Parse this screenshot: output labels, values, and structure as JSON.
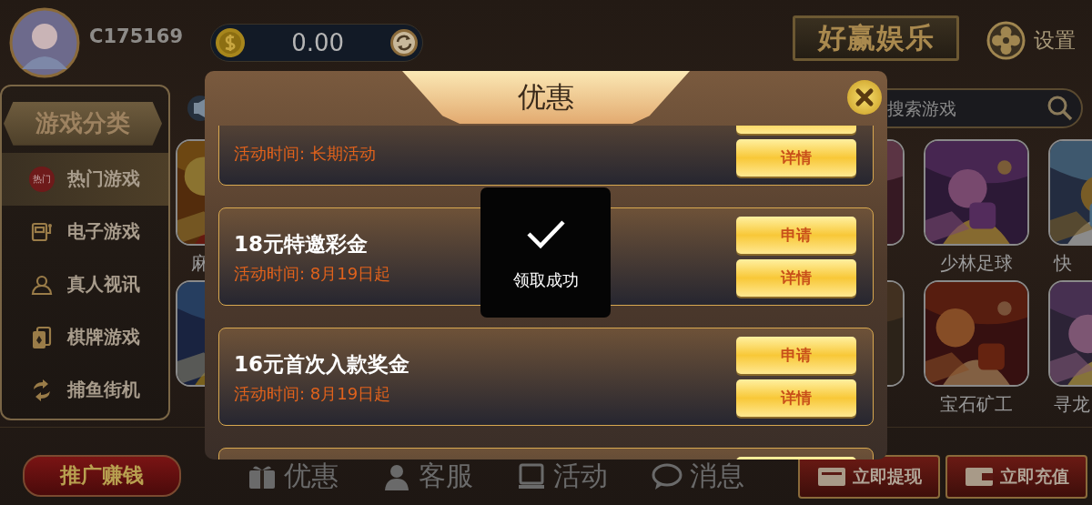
{
  "user": {
    "id": "C175169"
  },
  "balance": {
    "amount": "0.00"
  },
  "logo": {
    "text": "好赢娱乐"
  },
  "settings": {
    "label": "设置"
  },
  "search": {
    "placeholder": "搜索游戏"
  },
  "sidebar": {
    "title": "游戏分类",
    "items": [
      {
        "label": "热门游戏",
        "kind": "hot",
        "badge": "热门",
        "selected": true
      },
      {
        "label": "电子游戏",
        "kind": "slot",
        "selected": false
      },
      {
        "label": "真人视讯",
        "kind": "live",
        "selected": false
      },
      {
        "label": "棋牌游戏",
        "kind": "cards",
        "selected": false
      },
      {
        "label": "捕鱼街机",
        "kind": "fish",
        "selected": false
      }
    ]
  },
  "game_rows": [
    {
      "tiles": [
        {
          "label": "麻",
          "kind": "picture"
        },
        {
          "kind": "picture"
        },
        {
          "label": "少林足球",
          "kind": "picture"
        },
        {
          "label": "快",
          "kind": "picture"
        }
      ]
    },
    {
      "tiles": [
        {
          "kind": "picture"
        },
        {
          "kind": "picture"
        },
        {
          "label": "宝石矿工",
          "kind": "picture"
        },
        {
          "label": "寻龙",
          "kind": "picture"
        }
      ]
    }
  ],
  "bottom_bar": {
    "promo": "推广赚钱",
    "nav": [
      {
        "label": "优惠",
        "kind": "gift"
      },
      {
        "label": "客服",
        "kind": "agent"
      },
      {
        "label": "活动",
        "kind": "screen"
      },
      {
        "label": "消息",
        "kind": "chat"
      }
    ],
    "actions": [
      {
        "label": "立即提现",
        "kind": "atm"
      },
      {
        "label": "立即充值",
        "kind": "wallet"
      }
    ]
  },
  "modal": {
    "title": "优惠",
    "offers": [
      {
        "time": "活动时间: 长期活动",
        "buttons": [
          {
            "kind": "stub"
          },
          {
            "kind": "button",
            "label": "详情"
          }
        ]
      },
      {
        "title": "18元特邀彩金",
        "time": "活动时间: 8月19日起",
        "buttons": [
          {
            "kind": "button",
            "label": "申请"
          },
          {
            "kind": "button",
            "label": "详情"
          }
        ]
      },
      {
        "title": "16元首次入款奖金",
        "time": "活动时间: 8月19日起",
        "buttons": [
          {
            "kind": "button",
            "label": "申请"
          },
          {
            "kind": "button",
            "label": "详情"
          }
        ]
      },
      {
        "buttons": [
          {
            "kind": "stub"
          }
        ]
      }
    ],
    "toast": {
      "message": "领取成功"
    }
  }
}
